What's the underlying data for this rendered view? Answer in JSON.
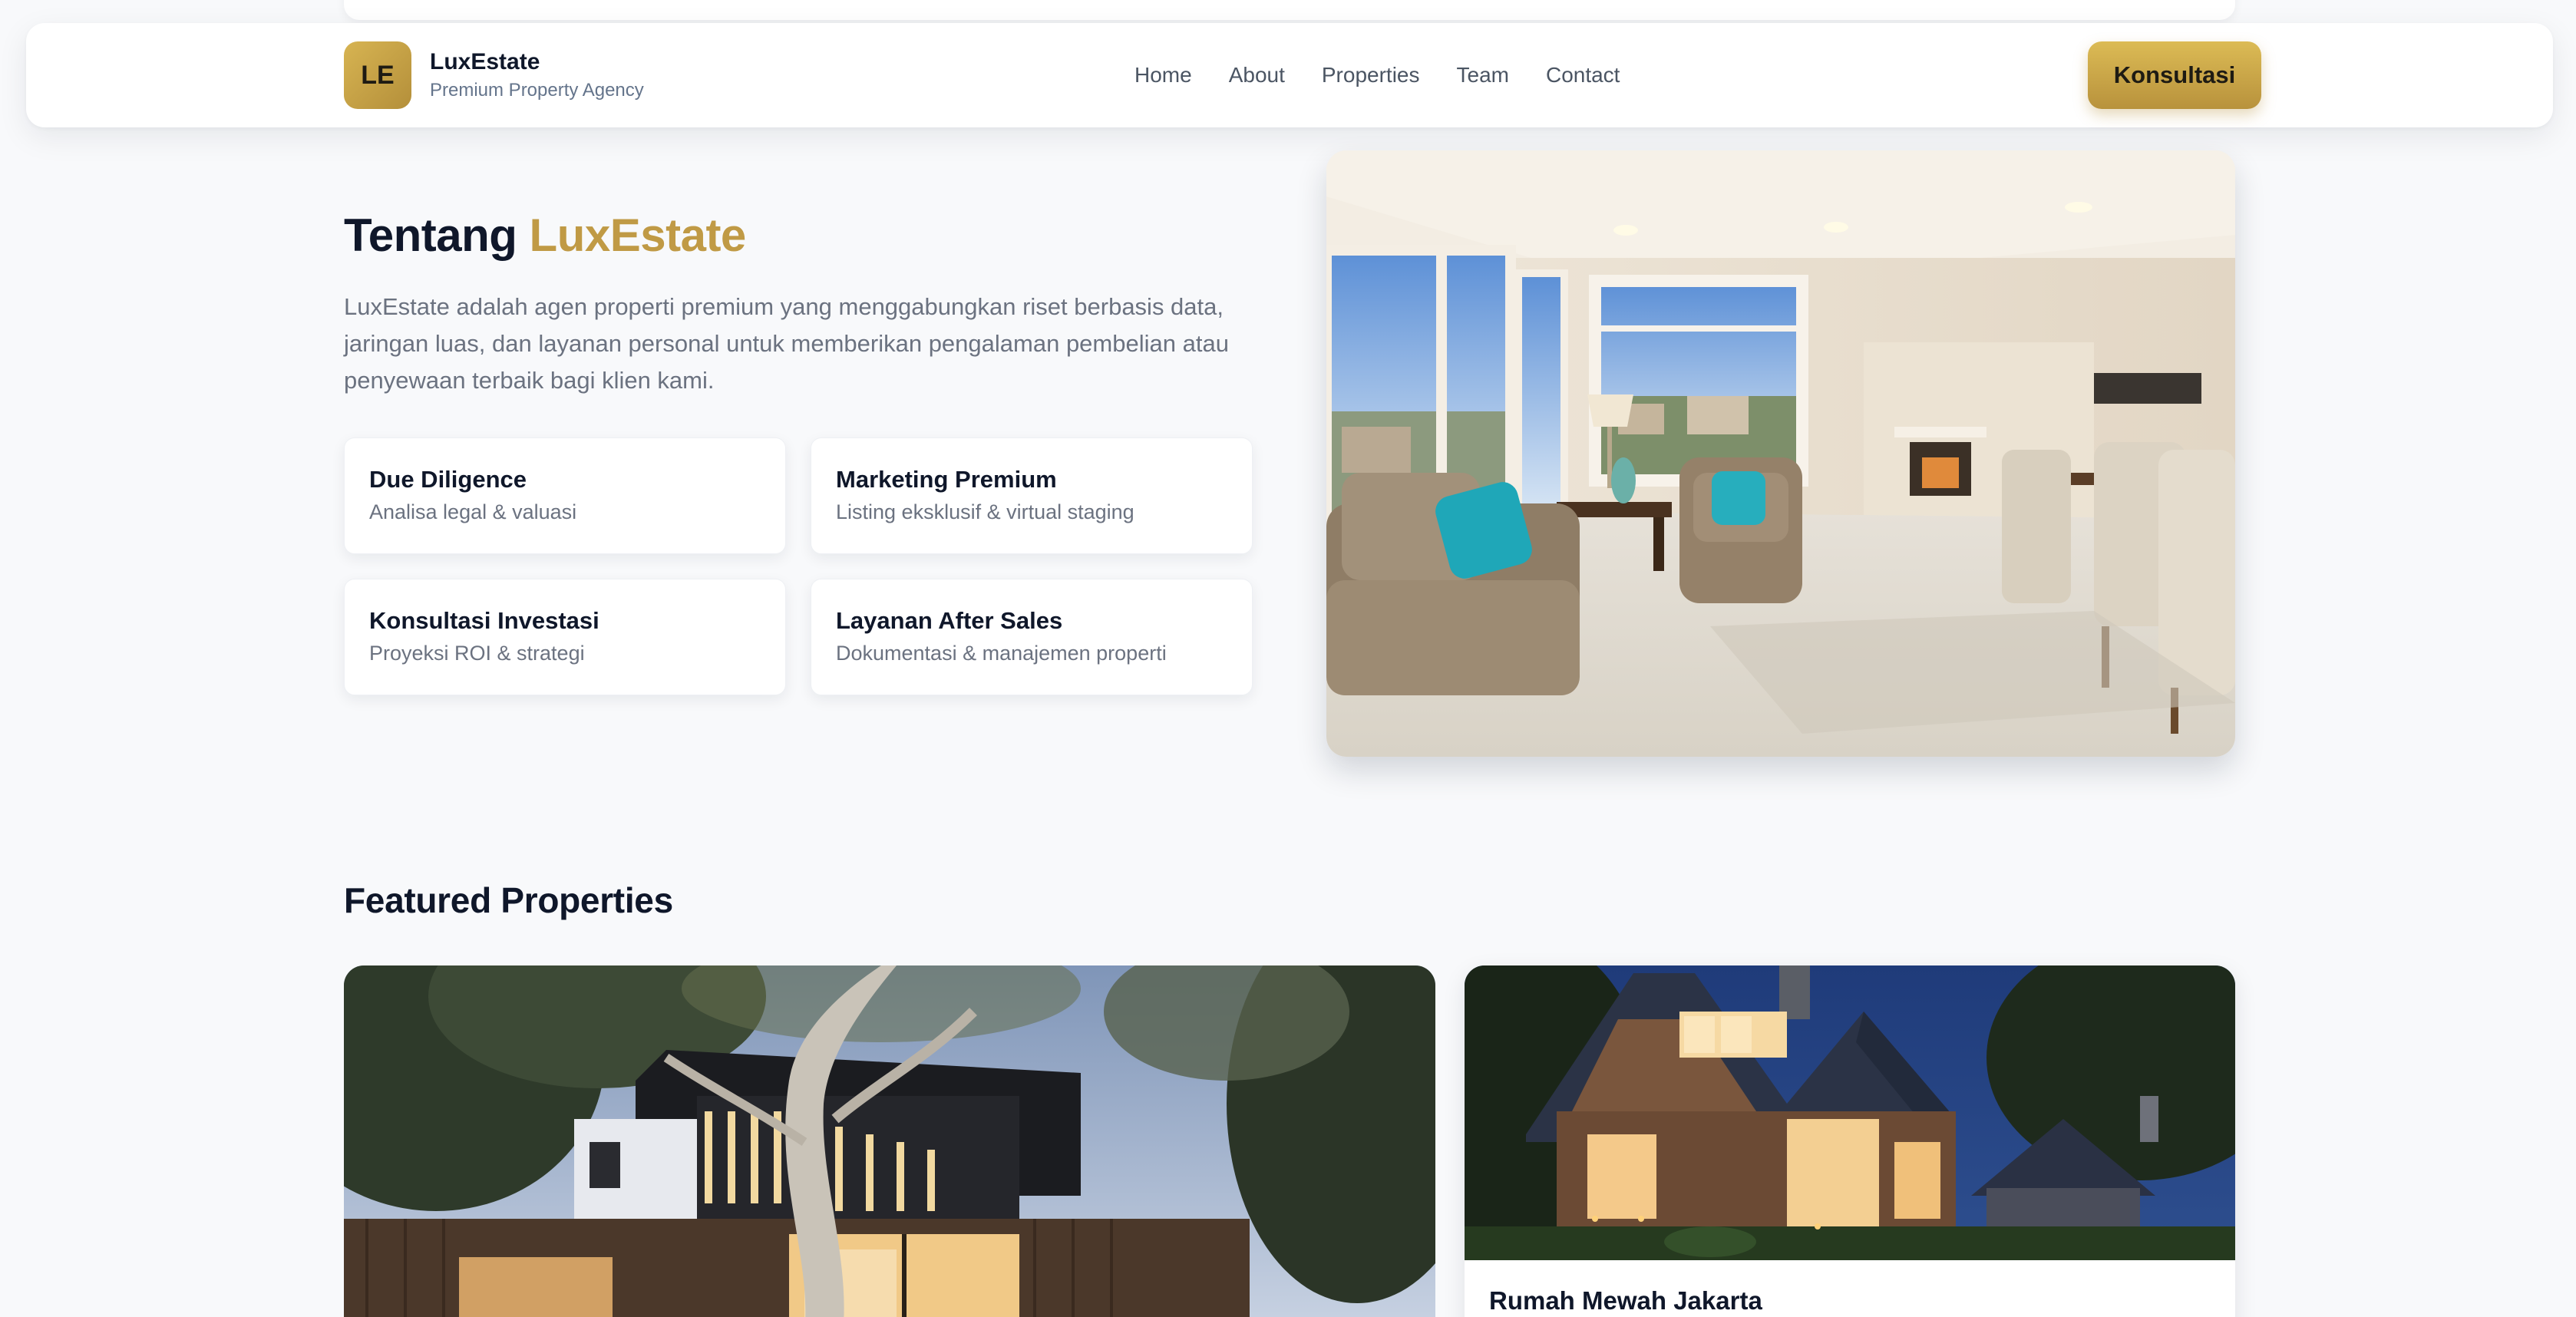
{
  "brand": {
    "logo_initials": "LE",
    "name": "LuxEstate",
    "tagline": "Premium Property Agency"
  },
  "nav": {
    "links": [
      "Home",
      "About",
      "Properties",
      "Team",
      "Contact"
    ],
    "cta_label": "Konsultasi"
  },
  "about": {
    "title_prefix": "Tentang",
    "title_accent": "LuxEstate",
    "description": "LuxEstate adalah agen properti premium yang menggabungkan riset berbasis data, jaringan luas, dan layanan personal untuk memberikan pengalaman pembelian atau penyewaan terbaik bagi klien kami.",
    "features": [
      {
        "title": "Due Diligence",
        "subtitle": "Analisa legal & valuasi"
      },
      {
        "title": "Marketing Premium",
        "subtitle": "Listing eksklusif & virtual staging"
      },
      {
        "title": "Konsultasi Investasi",
        "subtitle": "Proyeksi ROI & strategi"
      },
      {
        "title": "Layanan After Sales",
        "subtitle": "Dokumentasi & manajemen properti"
      }
    ]
  },
  "featured": {
    "title": "Featured Properties",
    "cards": [
      {
        "title": ""
      },
      {
        "title": "Rumah Mewah Jakarta"
      }
    ]
  },
  "colors": {
    "accent_gold": "#c09a45",
    "cta_gold": "#d7b452",
    "heading": "#0f172a",
    "muted": "#6b7280",
    "background": "#f8f9fb"
  }
}
